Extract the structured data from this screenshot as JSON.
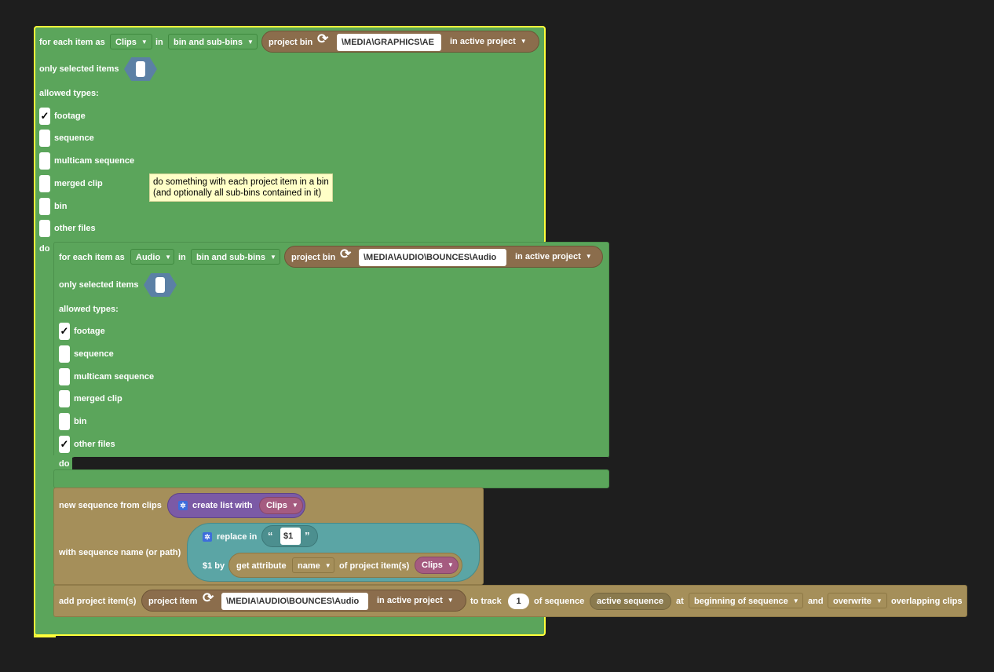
{
  "outer": {
    "for_each_label": "for each item as",
    "var": "Clips",
    "in_label": "in",
    "bin_mode": "bin and sub-bins",
    "project_bin_label": "project bin",
    "bin_path": "\\MEDIA\\GRAPHICS\\AE",
    "project_scope": "in active project",
    "only_selected_label": "only selected items",
    "allowed_types_label": "allowed types:",
    "types": [
      {
        "label": "footage",
        "checked": true
      },
      {
        "label": "sequence",
        "checked": false
      },
      {
        "label": "multicam sequence",
        "checked": false
      },
      {
        "label": "merged clip",
        "checked": false
      },
      {
        "label": "bin",
        "checked": false
      },
      {
        "label": "other files",
        "checked": false
      }
    ],
    "do_label": "do"
  },
  "tooltip": {
    "line1": "do something with each project item in a bin",
    "line2": "(and optionally all sub-bins contained in it)"
  },
  "inner": {
    "for_each_label": "for each item as",
    "var": "Audio",
    "in_label": "in",
    "bin_mode": "bin and sub-bins",
    "project_bin_label": "project bin",
    "bin_path": "\\MEDIA\\AUDIO\\BOUNCES\\Audio",
    "project_scope": "in active project",
    "only_selected_label": "only selected items",
    "allowed_types_label": "allowed types:",
    "types": [
      {
        "label": "footage",
        "checked": true
      },
      {
        "label": "sequence",
        "checked": false
      },
      {
        "label": "multicam sequence",
        "checked": false
      },
      {
        "label": "merged clip",
        "checked": false
      },
      {
        "label": "bin",
        "checked": false
      },
      {
        "label": "other files",
        "checked": true
      }
    ],
    "do_label": "do"
  },
  "new_sequence": {
    "label": "new sequence from clips",
    "create_list_label": "create list with",
    "list_var": "Clips",
    "name_label": "with sequence name (or path)",
    "replace_label": "replace in",
    "open_quote": "“",
    "close_quote": "”",
    "placeholder": "$1",
    "by_label": "$1 by",
    "get_attr_label": "get attribute",
    "attr": "name",
    "of_items_label": "of project item(s)",
    "items_var": "Clips"
  },
  "add_items": {
    "label": "add project item(s)",
    "project_item_label": "project item",
    "item_path": "\\MEDIA\\AUDIO\\BOUNCES\\Audio",
    "project_scope": "in active project",
    "to_track_label": "to track",
    "track": "1",
    "of_sequence_label": "of sequence",
    "sequence": "active sequence",
    "at_label": "at",
    "position": "beginning of sequence",
    "and_label": "and",
    "mode": "overwrite",
    "tail_label": "overlapping clips"
  },
  "colors": {
    "loop_block": "#5ba55b",
    "selection_outline": "#ffff3a",
    "action_block": "#a58f5a",
    "project_pill": "#8b6d4c",
    "list_block": "#7b5aa6",
    "text_block": "#5ba5a5",
    "variable": "#a55b80",
    "boolean": "#5b80a5"
  }
}
